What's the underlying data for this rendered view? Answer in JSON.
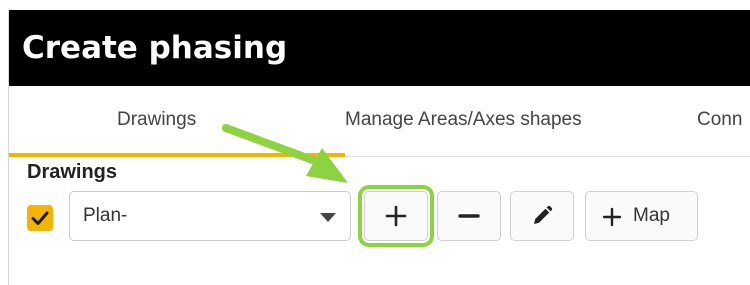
{
  "window": {
    "title": "Create phasing"
  },
  "tabs": [
    {
      "label": "Drawings",
      "active": true
    },
    {
      "label": "Manage Areas/Axes shapes",
      "active": false
    },
    {
      "label": "Conn",
      "active": false
    }
  ],
  "drawings_section": {
    "label": "Drawings",
    "checkbox_checked": true,
    "select_value": "Plan-",
    "buttons": {
      "add_icon": "plus-icon",
      "remove_icon": "minus-icon",
      "edit_icon": "pencil-icon",
      "map_label": "Map"
    }
  },
  "colors": {
    "accent_yellow": "#f4b400",
    "highlight_green": "#8bd33f",
    "title_bar": "#000000"
  }
}
